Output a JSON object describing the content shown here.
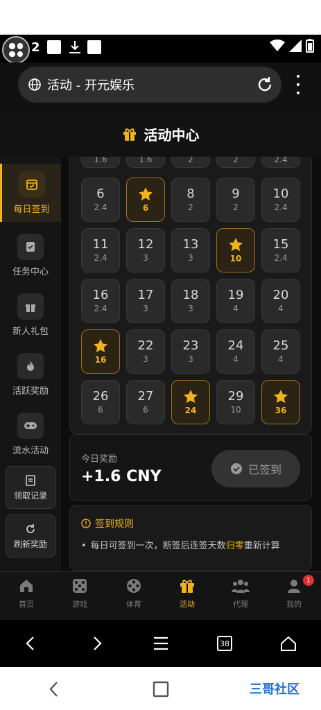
{
  "status": {
    "notif_count": "2"
  },
  "browser": {
    "url_title": "活动 - 开元娱乐"
  },
  "header": {
    "title": "活动中心"
  },
  "sidebar": {
    "items": [
      {
        "label": "每日签到"
      },
      {
        "label": "任务中心"
      },
      {
        "label": "新人礼包"
      },
      {
        "label": "活跃奖励"
      },
      {
        "label": "流水活动"
      }
    ],
    "buttons": [
      {
        "label": "领取记录"
      },
      {
        "label": "刷新奖励"
      }
    ]
  },
  "calendar": {
    "partial_top": [
      {
        "value": "1.6"
      },
      {
        "value": "1.6"
      },
      {
        "value": "2"
      },
      {
        "value": "2"
      },
      {
        "value": "2.4"
      }
    ],
    "days": [
      {
        "day": "6",
        "value": "2.4",
        "star": false
      },
      {
        "day": "",
        "value": "6",
        "star": true
      },
      {
        "day": "8",
        "value": "2",
        "star": false
      },
      {
        "day": "9",
        "value": "2",
        "star": false
      },
      {
        "day": "10",
        "value": "2.4",
        "star": false
      },
      {
        "day": "11",
        "value": "2.4",
        "star": false
      },
      {
        "day": "12",
        "value": "3",
        "star": false
      },
      {
        "day": "13",
        "value": "3",
        "star": false
      },
      {
        "day": "",
        "value": "10",
        "star": true
      },
      {
        "day": "15",
        "value": "2.4",
        "star": false
      },
      {
        "day": "16",
        "value": "2.4",
        "star": false
      },
      {
        "day": "17",
        "value": "3",
        "star": false
      },
      {
        "day": "18",
        "value": "3",
        "star": false
      },
      {
        "day": "19",
        "value": "4",
        "star": false
      },
      {
        "day": "20",
        "value": "4",
        "star": false
      },
      {
        "day": "",
        "value": "16",
        "star": true
      },
      {
        "day": "22",
        "value": "3",
        "star": false
      },
      {
        "day": "23",
        "value": "3",
        "star": false
      },
      {
        "day": "24",
        "value": "4",
        "star": false
      },
      {
        "day": "25",
        "value": "4",
        "star": false
      },
      {
        "day": "26",
        "value": "6",
        "star": false
      },
      {
        "day": "27",
        "value": "6",
        "star": false
      },
      {
        "day": "",
        "value": "24",
        "star": true
      },
      {
        "day": "29",
        "value": "10",
        "star": false
      },
      {
        "day": "",
        "value": "36",
        "star": true
      }
    ]
  },
  "reward": {
    "label": "今日奖励",
    "value": "+1.6 CNY",
    "signed_label": "已签到"
  },
  "rules": {
    "title": "签到规则",
    "text_before": "每日可签到一次，断签后连签天数",
    "highlight": "归零",
    "text_after": "重新计算"
  },
  "tabbar": {
    "items": [
      {
        "label": "首页"
      },
      {
        "label": "游戏"
      },
      {
        "label": "体育"
      },
      {
        "label": "活动"
      },
      {
        "label": "代理"
      },
      {
        "label": "我的"
      }
    ],
    "badge": "1"
  },
  "browser_nav": {
    "tab_count": "38"
  },
  "watermark": "三哥社区",
  "colors": {
    "accent": "#f2b21e",
    "background": "#0d0d0d",
    "card": "#2a2a2a"
  }
}
